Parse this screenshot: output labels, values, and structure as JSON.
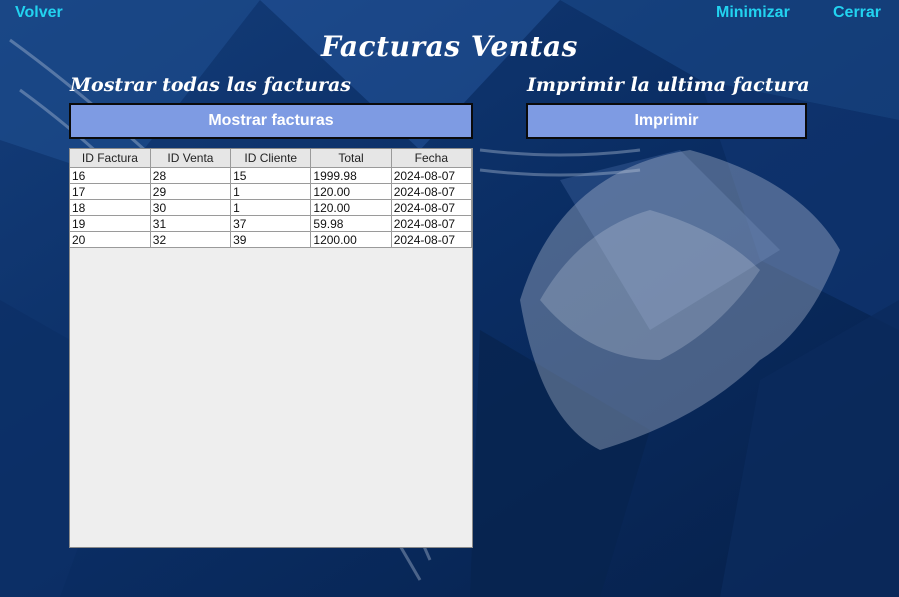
{
  "header": {
    "back_label": "Volver",
    "minimize_label": "Minimizar",
    "close_label": "Cerrar"
  },
  "title": "Facturas Ventas",
  "left_panel": {
    "subtitle": "Mostrar todas las facturas",
    "button_label": "Mostrar facturas"
  },
  "right_panel": {
    "subtitle": "Imprimir la ultima factura",
    "button_label": "Imprimir"
  },
  "table": {
    "columns": [
      "ID Factura",
      "ID Venta",
      "ID Cliente",
      "Total",
      "Fecha"
    ],
    "rows": [
      [
        "16",
        "28",
        "15",
        "1999.98",
        "2024-08-07"
      ],
      [
        "17",
        "29",
        "1",
        "120.00",
        "2024-08-07"
      ],
      [
        "18",
        "30",
        "1",
        "120.00",
        "2024-08-07"
      ],
      [
        "19",
        "31",
        "37",
        "59.98",
        "2024-08-07"
      ],
      [
        "20",
        "32",
        "39",
        "1200.00",
        "2024-08-07"
      ]
    ]
  },
  "colors": {
    "link": "#22d3f0",
    "button": "#7e9be3",
    "background": "#0b2a5c"
  }
}
